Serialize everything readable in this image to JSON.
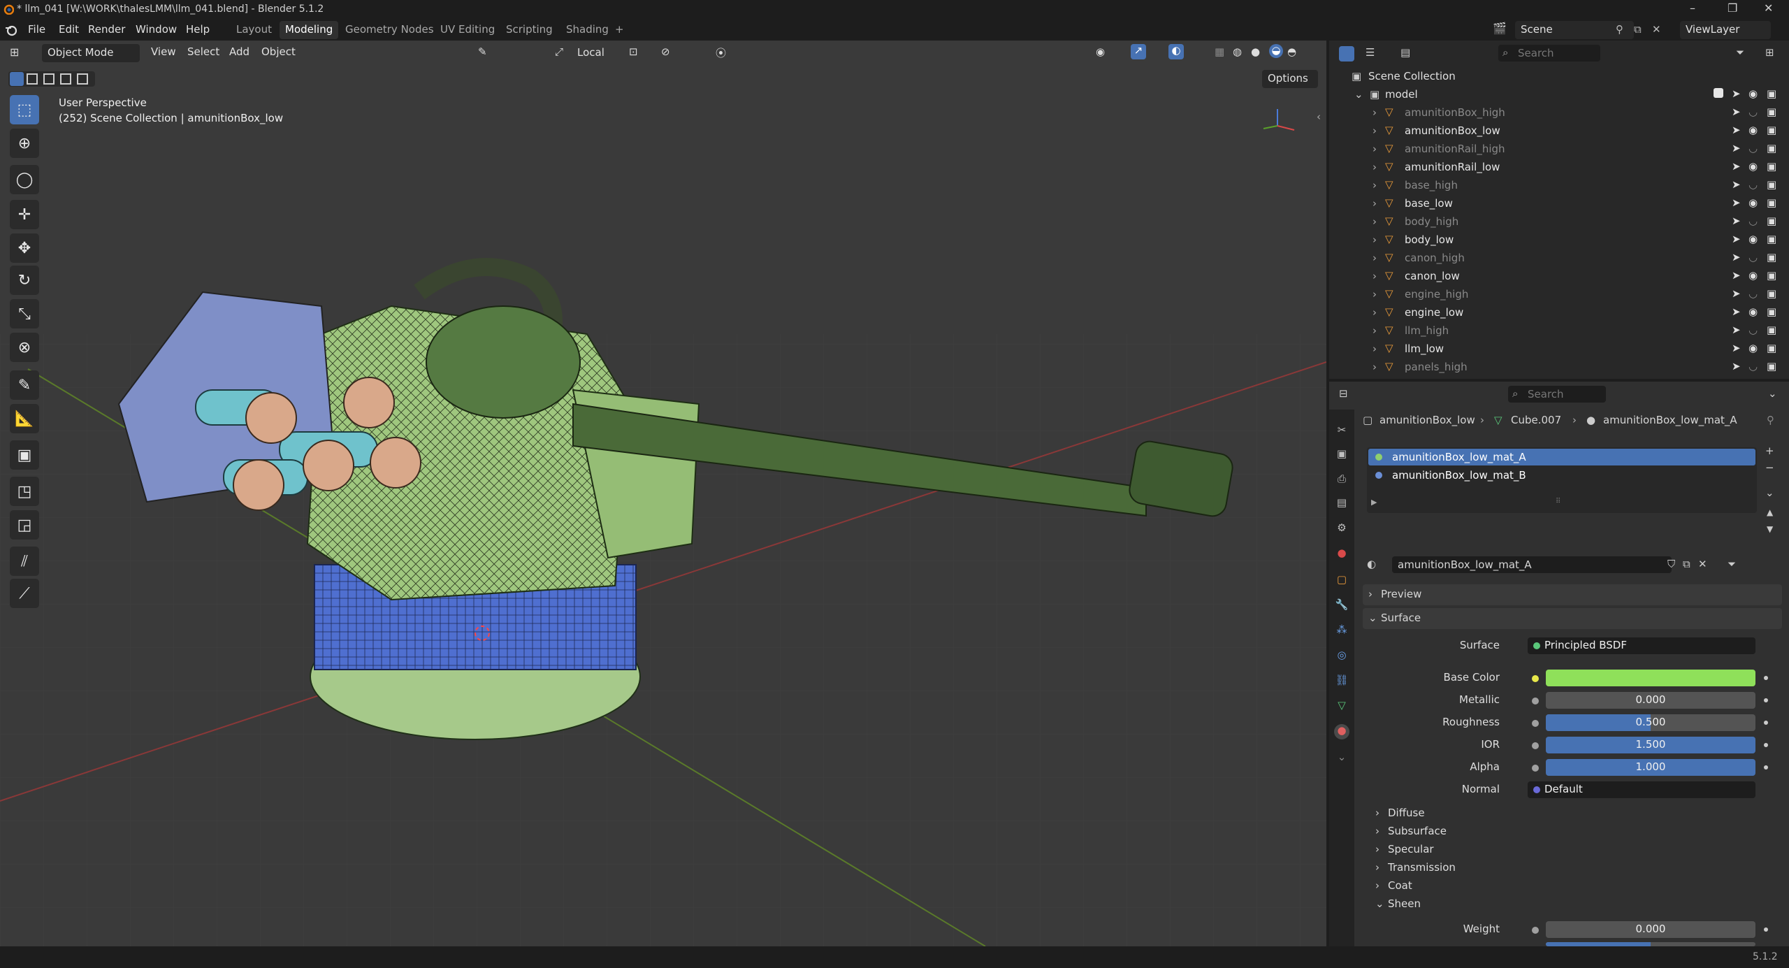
{
  "window": {
    "title": "* llm_041 [W:\\WORK\\thalesLMM\\llm_041.blend] - Blender 5.1.2"
  },
  "menu": [
    "File",
    "Edit",
    "Render",
    "Window",
    "Help"
  ],
  "workspaces": [
    "Layout",
    "Modeling",
    "Geometry Nodes",
    "UV Editing",
    "Scripting",
    "Shading",
    "+"
  ],
  "scene": {
    "label": "Scene",
    "viewlayer": "ViewLayer"
  },
  "viewport": {
    "mode": "Object Mode",
    "menus": [
      "View",
      "Select",
      "Add",
      "Object"
    ],
    "transform_orientation": "Local",
    "options_label": "Options",
    "perspective": "User Perspective",
    "context": "(252) Scene Collection | amunitionBox_low"
  },
  "outliner": {
    "search_placeholder": "Search",
    "root": "Scene Collection",
    "collection": "model",
    "items": [
      {
        "name": "amunitionBox_high",
        "visible": false
      },
      {
        "name": "amunitionBox_low",
        "visible": true
      },
      {
        "name": "amunitionRail_high",
        "visible": false
      },
      {
        "name": "amunitionRail_low",
        "visible": true
      },
      {
        "name": "base_high",
        "visible": false
      },
      {
        "name": "base_low",
        "visible": true
      },
      {
        "name": "body_high",
        "visible": false
      },
      {
        "name": "body_low",
        "visible": true
      },
      {
        "name": "canon_high",
        "visible": false
      },
      {
        "name": "canon_low",
        "visible": true
      },
      {
        "name": "engine_high",
        "visible": false
      },
      {
        "name": "engine_low",
        "visible": true
      },
      {
        "name": "llm_high",
        "visible": false
      },
      {
        "name": "llm_low",
        "visible": true
      },
      {
        "name": "panels_high",
        "visible": false
      }
    ]
  },
  "properties": {
    "search_placeholder": "Search",
    "breadcrumb": [
      "amunitionBox_low",
      "Cube.007",
      "amunitionBox_low_mat_A"
    ],
    "materials": [
      {
        "name": "amunitionBox_low_mat_A",
        "selected": true,
        "color": "#8fcf6e"
      },
      {
        "name": "amunitionBox_low_mat_B",
        "selected": false,
        "color": "#6b8fd6"
      }
    ],
    "material_name": "amunitionBox_low_mat_A",
    "panels": {
      "preview": "Preview",
      "surface": "Surface"
    },
    "surface": {
      "surface_label": "Surface",
      "surface_value": "Principled BSDF",
      "base_color_label": "Base Color",
      "base_color": "#8fe05a",
      "metallic_label": "Metallic",
      "metallic": "0.000",
      "roughness_label": "Roughness",
      "roughness": "0.500",
      "roughness_fill": 0.5,
      "ior_label": "IOR",
      "ior": "1.500",
      "alpha_label": "Alpha",
      "alpha": "1.000",
      "normal_label": "Normal",
      "normal": "Default"
    },
    "subpanels": [
      "Diffuse",
      "Subsurface",
      "Specular",
      "Transmission",
      "Coat",
      "Sheen"
    ],
    "sheen": {
      "weight_label": "Weight",
      "weight": "0.000"
    }
  },
  "status": {
    "version": "5.1.2"
  },
  "colors": {
    "accent": "#4772b3",
    "mesh_green": "#9fc77e",
    "mesh_blue": "#4f6fd0"
  }
}
